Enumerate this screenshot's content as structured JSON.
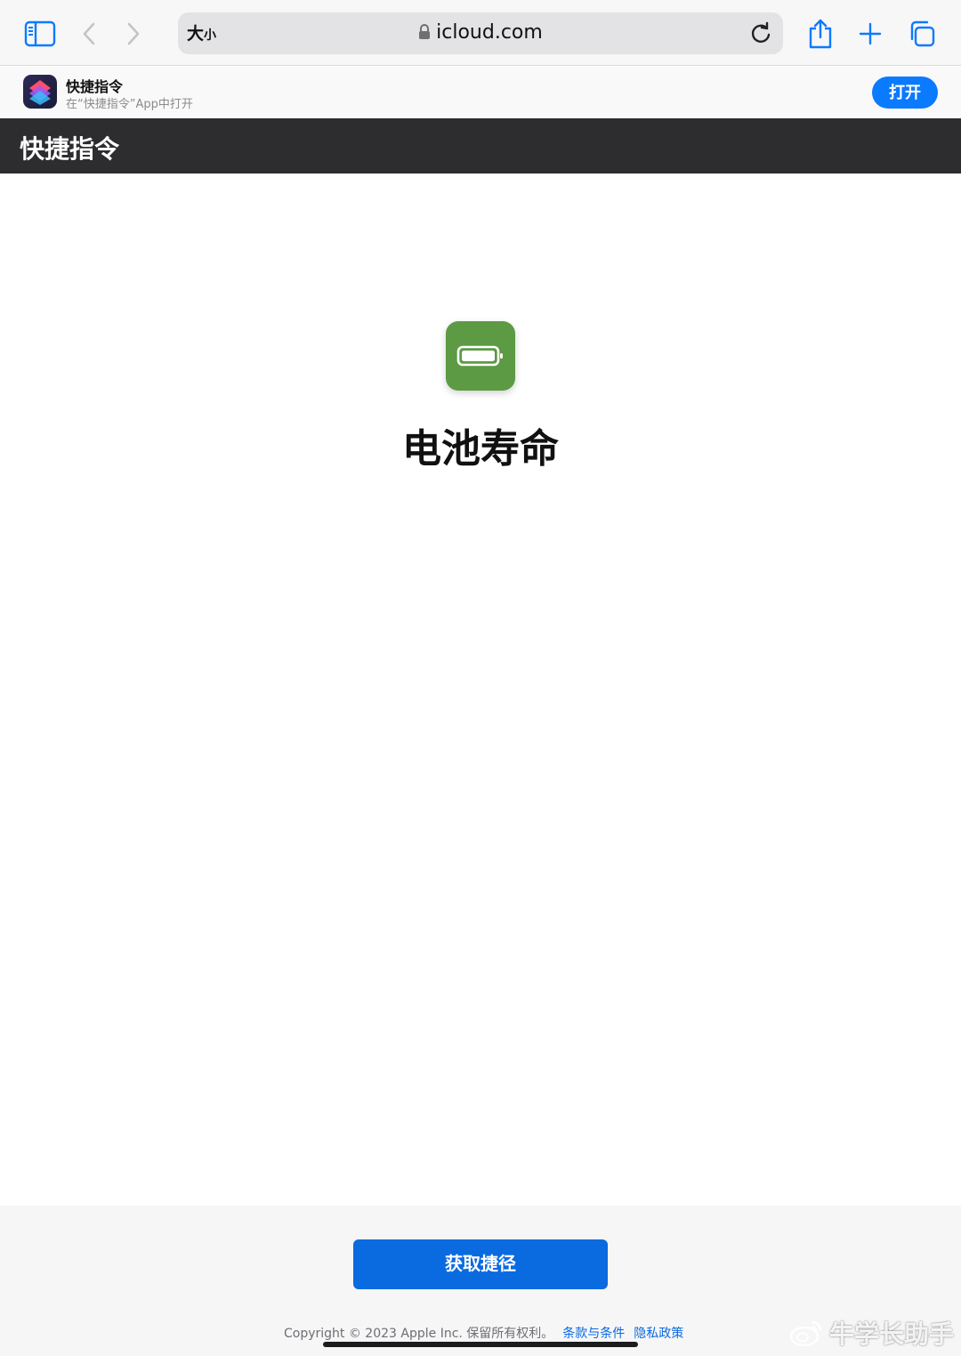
{
  "browser": {
    "text_size_label_large": "大",
    "text_size_label_small": "小",
    "url": "icloud.com"
  },
  "app_banner": {
    "title": "快捷指令",
    "subtitle": "在“快捷指令”App中打开",
    "open_label": "打开"
  },
  "page_header": {
    "title": "快捷指令"
  },
  "shortcut": {
    "name": "电池寿命",
    "icon": "battery-icon",
    "icon_color": "#5c9a44"
  },
  "footer": {
    "get_button_label": "获取捷径",
    "copyright": "Copyright © 2023 Apple Inc. 保留所有权利。",
    "terms_link": "条款与条件",
    "privacy_link": "隐私政策"
  },
  "watermark": {
    "text": "牛学长助手"
  },
  "colors": {
    "accent": "#0a7aff",
    "button_blue": "#0a6ae0",
    "header_dark": "#2d2d2f"
  }
}
